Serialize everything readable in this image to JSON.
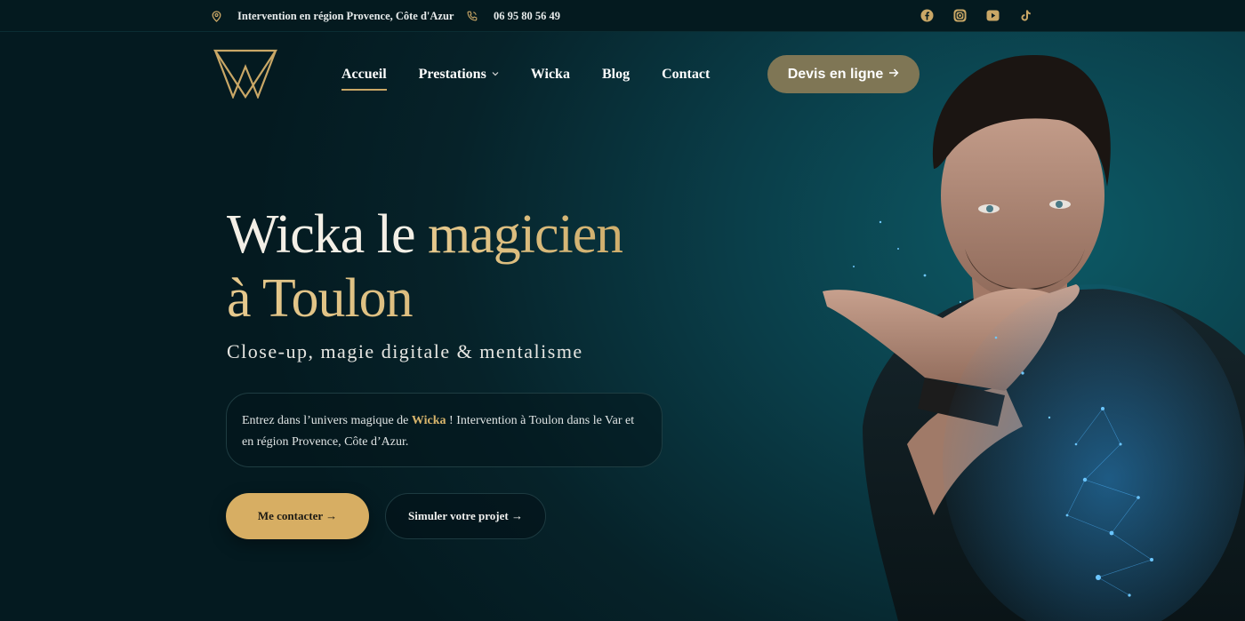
{
  "topbar": {
    "location": "Intervention en région Provence, Côte d'Azur",
    "phone": "06 95 80 56 49",
    "socials": [
      "facebook-icon",
      "instagram-icon",
      "youtube-icon",
      "tiktok-icon"
    ]
  },
  "nav": {
    "items": [
      {
        "label": "Accueil",
        "active": true
      },
      {
        "label": "Prestations",
        "dropdown": true
      },
      {
        "label": "Wicka"
      },
      {
        "label": "Blog"
      },
      {
        "label": "Contact"
      }
    ],
    "cta": "Devis en ligne"
  },
  "hero": {
    "title_white": "Wicka le ",
    "title_gold_1": "magicien",
    "title_gold_2": "à Toulon",
    "subtitle": "Close-up, magie digitale & mentalisme",
    "intro_before": "Entrez dans l’univers magique de ",
    "intro_brand": "Wicka",
    "intro_after": " ! Intervention à Toulon dans le Var et en région Provence, Côte d’Azur.",
    "btn_contact": "Me contacter →",
    "btn_simuler": "Simuler votre projet →"
  },
  "colors": {
    "accent_gold": "#d7ae63",
    "cta_olive": "#7f7655",
    "background": "#062229",
    "particles": "#4fb7ff"
  }
}
